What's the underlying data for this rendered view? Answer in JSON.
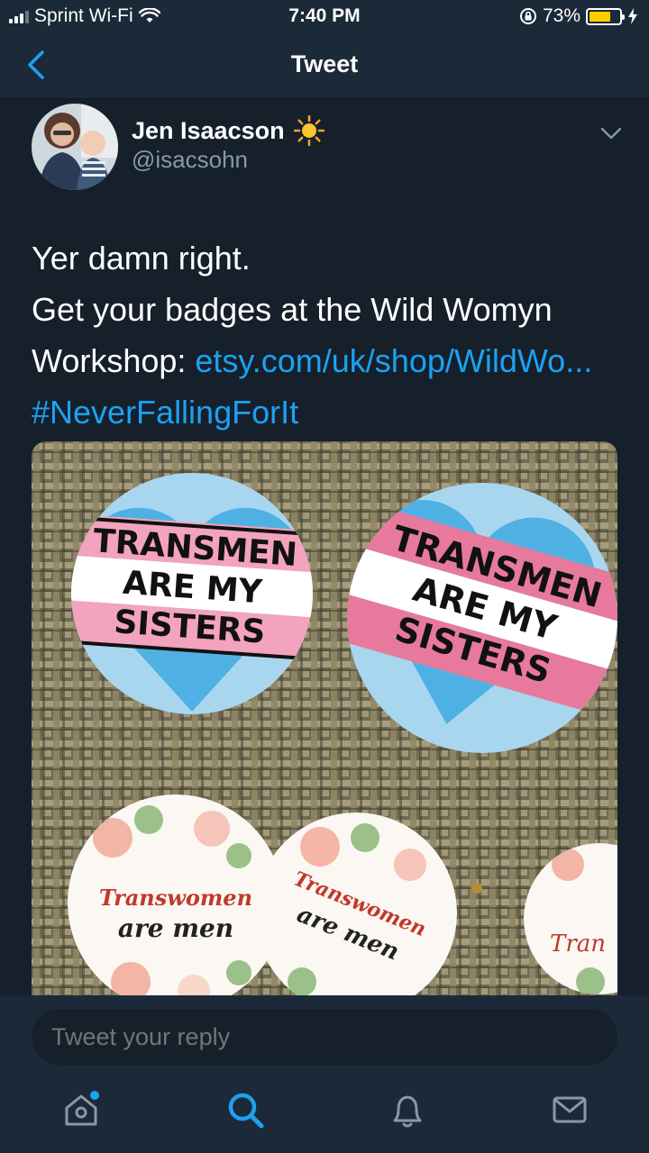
{
  "status_bar": {
    "carrier": "Sprint Wi-Fi",
    "time": "7:40 PM",
    "battery_percent": "73%",
    "battery_level": 0.73,
    "icons": [
      "signal-icon",
      "wifi-icon",
      "rotation-lock-icon",
      "battery-icon",
      "charging-icon"
    ]
  },
  "nav": {
    "title": "Tweet",
    "back_icon": "chevron-left-icon"
  },
  "tweet": {
    "display_name": "Jen Isaacson",
    "name_emoji": "sun-icon",
    "handle": "@isacsohn",
    "text_line1": "Yer damn right.",
    "text_line2": "Get your badges at the Wild Womyn",
    "text_line3_prefix": "Workshop: ",
    "link": "etsy.com/uk/shop/WildWo...",
    "hashtag": "#NeverFallingForIt",
    "badge_top_line1": "TRANSMEN",
    "badge_top_line2": "ARE MY",
    "badge_top_line3": "SISTERS",
    "badge_bottom_line1": "Transwomen",
    "badge_bottom_line2": "are men"
  },
  "reply": {
    "placeholder": "Tweet your reply"
  },
  "tab_bar": {
    "tabs": [
      "home-icon",
      "search-icon",
      "notifications-icon",
      "messages-icon"
    ],
    "accent": "#1da1f2"
  },
  "colors": {
    "background": "#15202b",
    "bar": "#1c2938",
    "accent": "#1da1f2",
    "secondary_text": "#8899a6"
  }
}
